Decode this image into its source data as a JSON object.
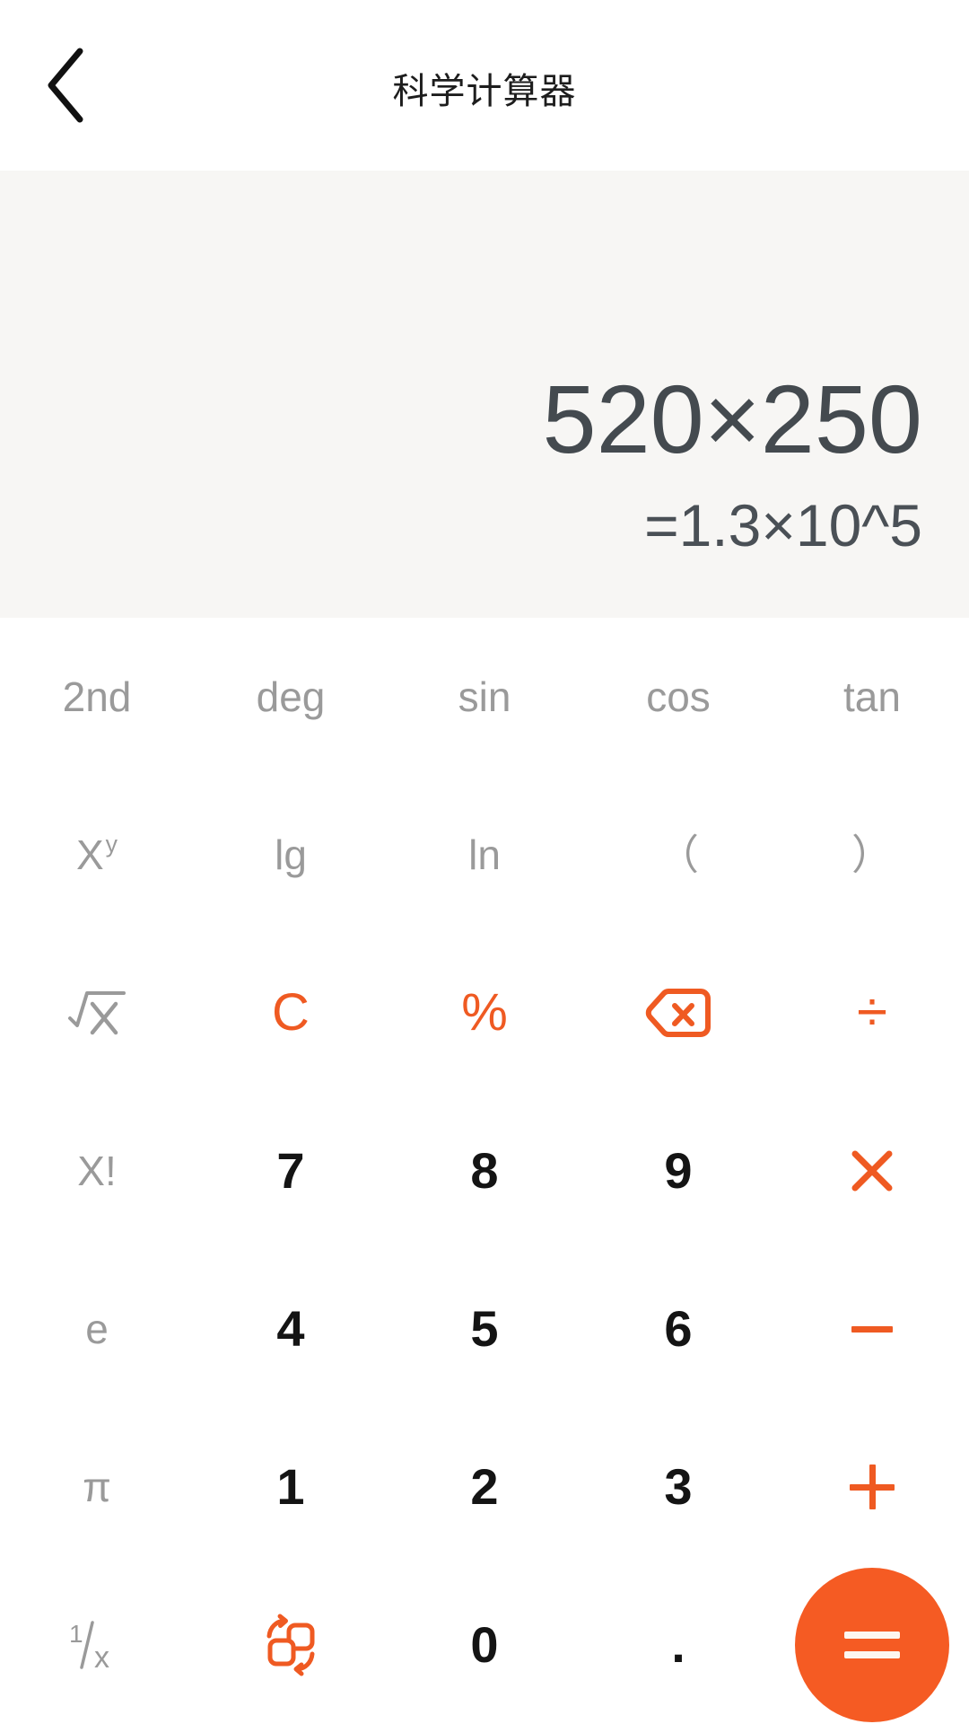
{
  "header": {
    "title": "科学计算器",
    "back_icon": "chevron-left-icon"
  },
  "display": {
    "expression": "520×250",
    "result": "=1.3×10^5"
  },
  "colors": {
    "accent": "#ef5a22",
    "equals_bg": "#f55b23",
    "display_bg": "#f7f6f4",
    "function_text": "#9a9a9a",
    "digit_text": "#141414",
    "expression_text": "#444a4f"
  },
  "keypad": {
    "rows": [
      [
        {
          "name": "key-2nd",
          "label": "2nd",
          "style": "fn"
        },
        {
          "name": "key-deg",
          "label": "deg",
          "style": "fn"
        },
        {
          "name": "key-sin",
          "label": "sin",
          "style": "fn"
        },
        {
          "name": "key-cos",
          "label": "cos",
          "style": "fn"
        },
        {
          "name": "key-tan",
          "label": "tan",
          "style": "fn"
        }
      ],
      [
        {
          "name": "key-power",
          "label": "X",
          "sup": "y",
          "style": "fn"
        },
        {
          "name": "key-lg",
          "label": "lg",
          "style": "fn"
        },
        {
          "name": "key-ln",
          "label": "ln",
          "style": "fn"
        },
        {
          "name": "key-paren-open",
          "label": "（",
          "style": "fn"
        },
        {
          "name": "key-paren-close",
          "label": "）",
          "style": "fn"
        }
      ],
      [
        {
          "name": "key-sqrt",
          "label": "√X",
          "style": "fn",
          "icon": "sqrt-icon"
        },
        {
          "name": "key-clear",
          "label": "C",
          "style": "op"
        },
        {
          "name": "key-percent",
          "label": "%",
          "style": "op"
        },
        {
          "name": "key-backspace",
          "label": "",
          "style": "op",
          "icon": "backspace-icon"
        },
        {
          "name": "key-divide",
          "label": "÷",
          "style": "op"
        }
      ],
      [
        {
          "name": "key-factorial",
          "label": "X!",
          "style": "fn"
        },
        {
          "name": "key-7",
          "label": "7",
          "style": "digit"
        },
        {
          "name": "key-8",
          "label": "8",
          "style": "digit"
        },
        {
          "name": "key-9",
          "label": "9",
          "style": "digit"
        },
        {
          "name": "key-multiply",
          "label": "×",
          "style": "op",
          "icon": "multiply-icon"
        }
      ],
      [
        {
          "name": "key-e",
          "label": "e",
          "style": "fn"
        },
        {
          "name": "key-4",
          "label": "4",
          "style": "digit"
        },
        {
          "name": "key-5",
          "label": "5",
          "style": "digit"
        },
        {
          "name": "key-6",
          "label": "6",
          "style": "digit"
        },
        {
          "name": "key-subtract",
          "label": "−",
          "style": "op",
          "icon": "minus-icon"
        }
      ],
      [
        {
          "name": "key-pi",
          "label": "π",
          "style": "fn"
        },
        {
          "name": "key-1",
          "label": "1",
          "style": "digit"
        },
        {
          "name": "key-2",
          "label": "2",
          "style": "digit"
        },
        {
          "name": "key-3",
          "label": "3",
          "style": "digit"
        },
        {
          "name": "key-add",
          "label": "+",
          "style": "op",
          "icon": "plus-icon"
        }
      ],
      [
        {
          "name": "key-reciprocal",
          "label": "1/x",
          "style": "fn",
          "icon": "fraction-icon"
        },
        {
          "name": "key-convert",
          "label": "",
          "style": "op",
          "icon": "convert-swap-icon"
        },
        {
          "name": "key-0",
          "label": "0",
          "style": "digit"
        },
        {
          "name": "key-decimal",
          "label": ".",
          "style": "dot"
        },
        {
          "name": "key-equals",
          "label": "=",
          "style": "equals",
          "icon": "equals-icon"
        }
      ]
    ]
  }
}
